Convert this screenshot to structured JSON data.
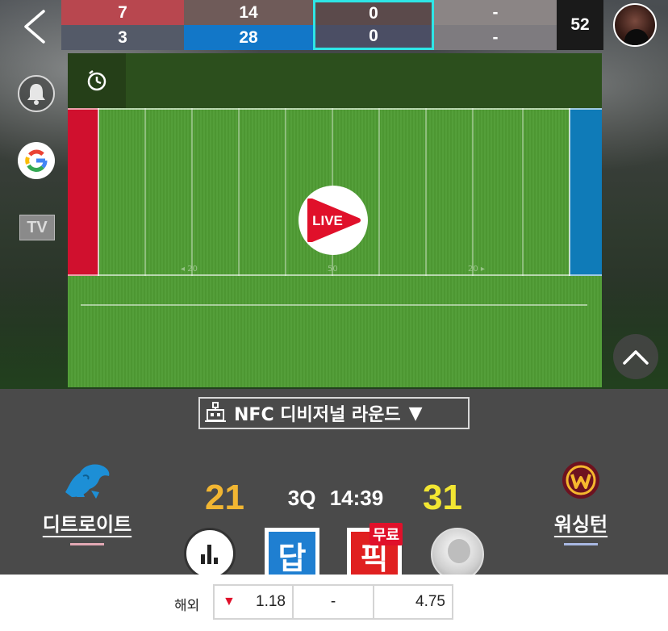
{
  "scoreboard": {
    "row1": [
      "7",
      "14",
      "0",
      "-"
    ],
    "row2": [
      "3",
      "28",
      "0",
      "-"
    ],
    "total": "52"
  },
  "side_icons": {
    "tv_label": "TV"
  },
  "live_label": "LIVE",
  "round": {
    "label": "NFC 디비저널 라운드",
    "arrow": "▼"
  },
  "game": {
    "home_team": "디트로이트",
    "away_team": "워싱턴",
    "home_score": "21",
    "away_score": "31",
    "quarter": "3Q",
    "time": "14:39"
  },
  "actions": {
    "answer_label": "답",
    "pick_label": "픽",
    "free_badge": "무료"
  },
  "odds": {
    "label": "해외",
    "trend": "▼",
    "home": "1.18",
    "draw": "-",
    "away": "4.75"
  },
  "field": {
    "yard_left": "◂ 20",
    "yard_mid": "50",
    "yard_right": "20 ▸"
  },
  "colors": {
    "home_endzone": "#d0102e",
    "away_endzone": "#0f7bb8",
    "home_score": "#f2b632",
    "away_score": "#f2e632",
    "highlight": "#2ee6e6"
  }
}
